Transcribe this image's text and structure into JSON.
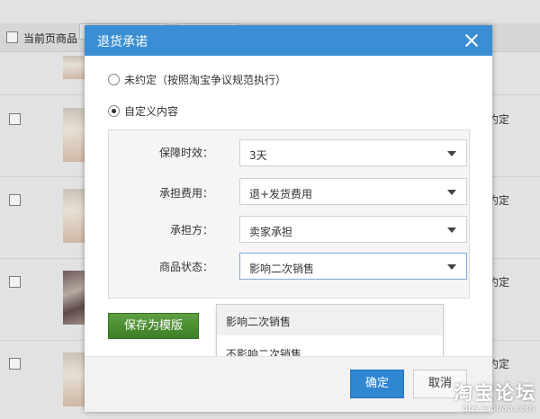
{
  "background": {
    "header_checkbox_label": "当前页商品",
    "side_labels": [
      "约定",
      "约定",
      "约定",
      "约定"
    ]
  },
  "modal": {
    "title": "退货承诺",
    "options": [
      {
        "label": "未约定（按照淘宝争议规范执行）",
        "selected": false
      },
      {
        "label": "自定义内容",
        "selected": true
      }
    ],
    "fields": [
      {
        "label": "保障时效：",
        "value": "3天"
      },
      {
        "label": "承担费用：",
        "value": "退+发货费用"
      },
      {
        "label": "承担方：",
        "value": "卖家承担"
      },
      {
        "label": "商品状态：",
        "value": "影响二次销售"
      }
    ],
    "dropdown_options": [
      "影响二次销售",
      "不影响二次销售"
    ],
    "save_template_label": "保存为模版",
    "ok_label": "确定",
    "cancel_label": "取消"
  },
  "watermark": {
    "main": "淘宝论坛",
    "sub": "bbs.taobao.com"
  },
  "colors": {
    "title_bar": "#3a8fd4",
    "ok_button": "#2f86d1",
    "save_button": "#4a8d31"
  }
}
